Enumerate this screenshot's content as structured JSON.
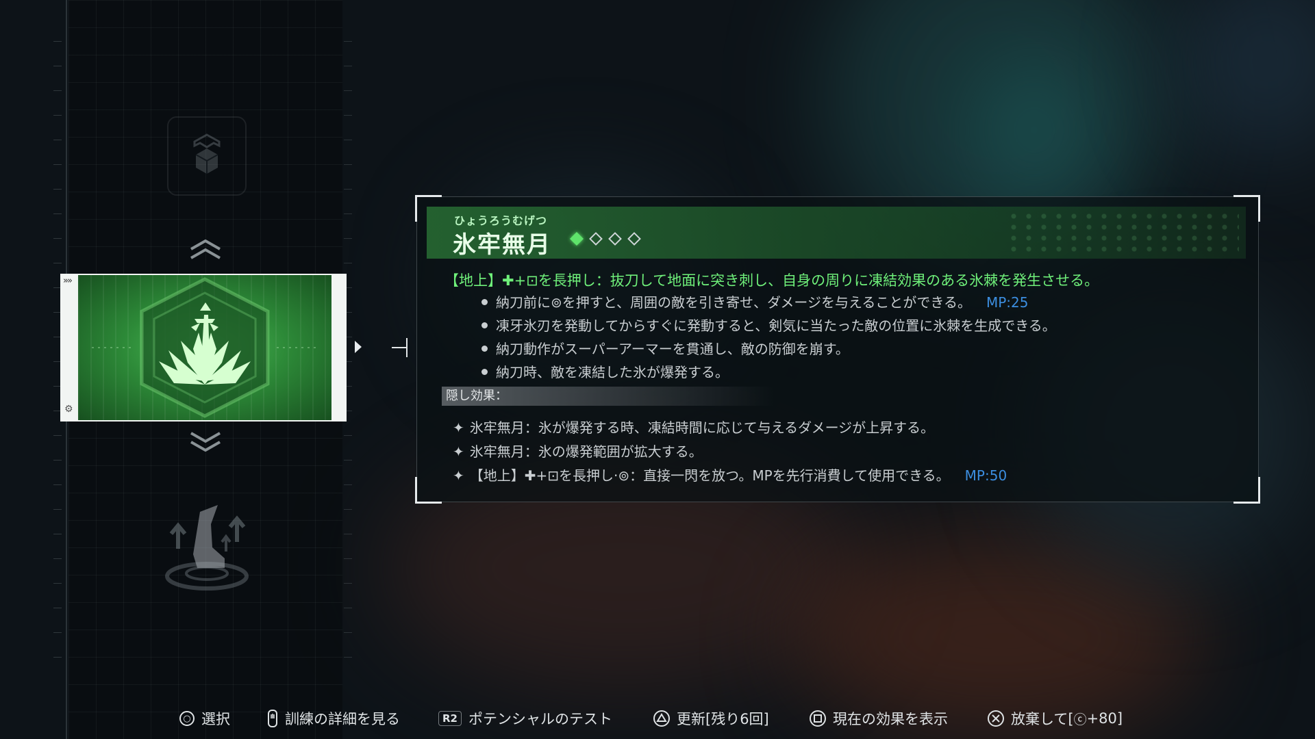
{
  "skill": {
    "ruby": "ひょうろうむげつ",
    "name": "氷牢無月",
    "level": 1,
    "max_level": 4,
    "main_effect": "【地上】✚+⊡を長押し：抜刀して地面に突き刺し、自身の周りに凍結効果のある氷棘を発生させる。",
    "details": [
      {
        "text": "納刀前に⊚を押すと、周囲の敵を引き寄せ、ダメージを与えることができる。",
        "mp": "MP:25"
      },
      {
        "text": "凍牙氷刃を発動してからすぐに発動すると、剣気に当たった敵の位置に氷棘を生成できる。",
        "mp": ""
      },
      {
        "text": "納刀動作がスーパーアーマーを貫通し、敵の防御を崩す。",
        "mp": ""
      },
      {
        "text": "納刀時、敵を凍結した氷が爆発する。",
        "mp": ""
      }
    ],
    "hidden_label": "隠し効果：",
    "hidden_effects": [
      {
        "text": "氷牢無月：氷が爆発する時、凍結時間に応じて与えるダメージが上昇する。",
        "mp": ""
      },
      {
        "text": "氷牢無月：氷の爆発範囲が拡大する。",
        "mp": ""
      },
      {
        "text": "【地上】✚+⊡を長押し·⊚：直接一閃を放つ。MPを先行消費して使用できる。",
        "mp": "MP:50"
      }
    ]
  },
  "icons": {
    "selected": "ice-spike-flower-icon",
    "above": "cube-icon",
    "below": "dash-boot-icon"
  },
  "footer": {
    "select": "選択",
    "details": "訓練の詳細を見る",
    "test_key": "R2",
    "test": "ポテンシャルのテスト",
    "update": "更新[残り6回]",
    "current": "現在の効果を表示",
    "discard": "放棄して[",
    "discard_value": "+80]"
  },
  "colors": {
    "accent_green": "#6ff07a",
    "mp_blue": "#3c8ee0"
  }
}
